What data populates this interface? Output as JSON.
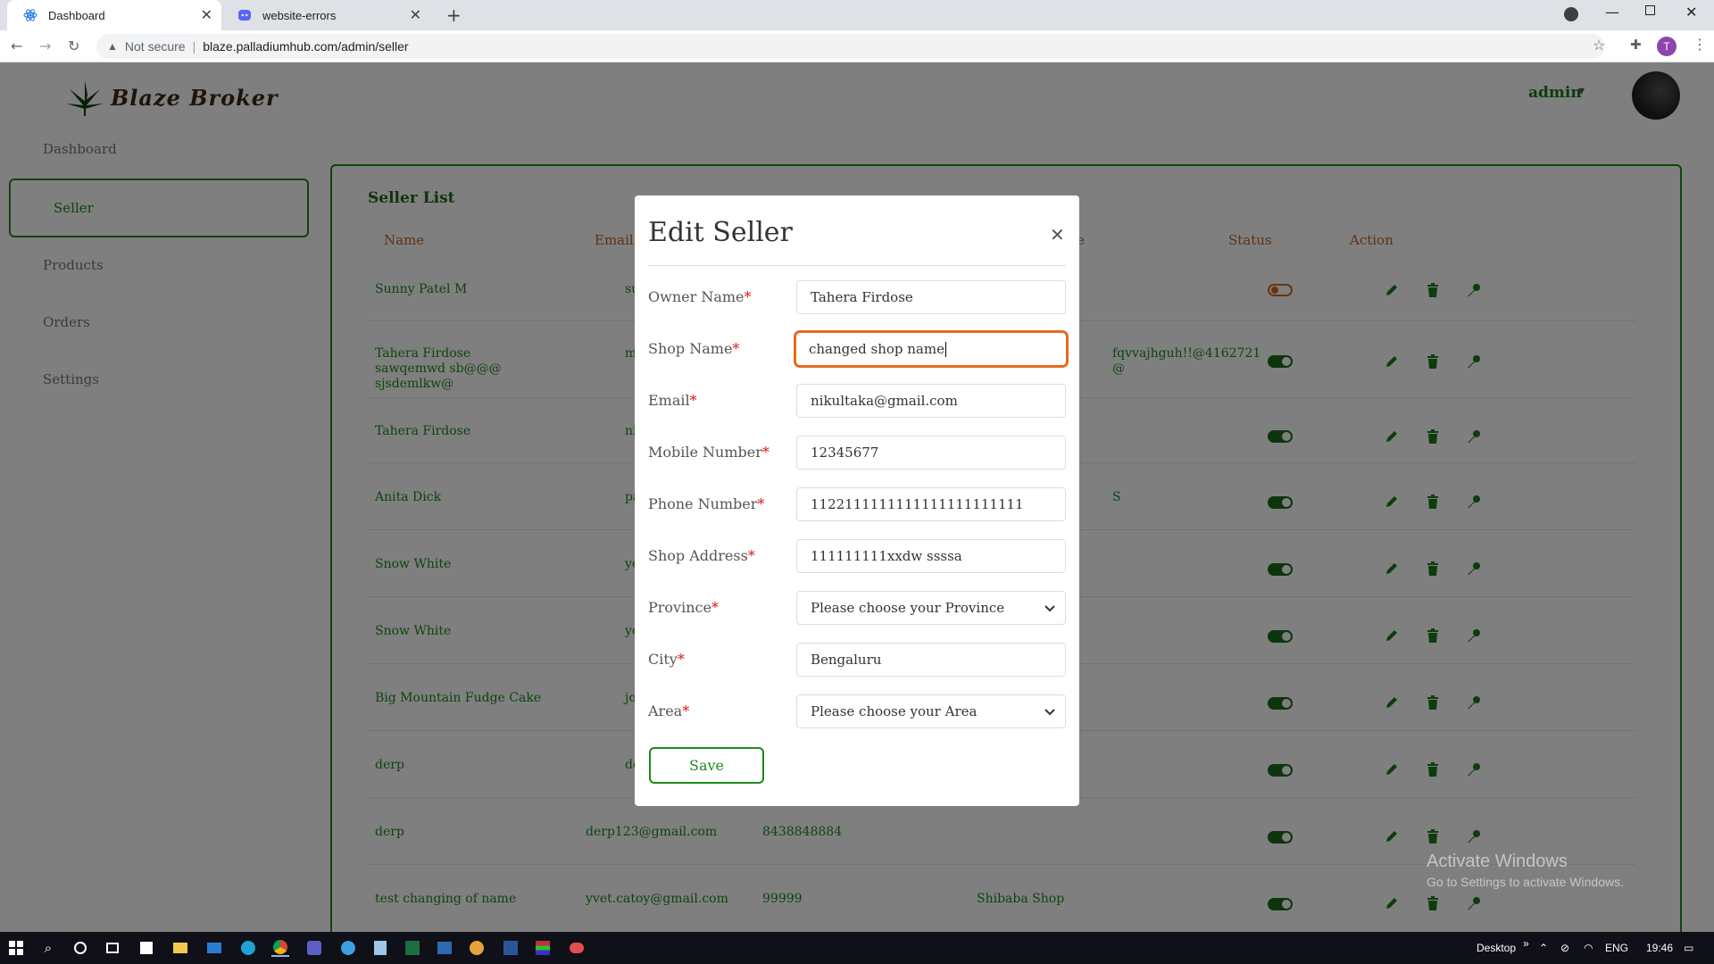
{
  "browser": {
    "tabs": [
      {
        "title": "Dashboard",
        "active": true
      },
      {
        "title": "website-errors",
        "active": false
      }
    ],
    "security_label": "Not secure",
    "url": "blaze.palladiumhub.com/admin/seller",
    "profile_initial": "T"
  },
  "header": {
    "logo_text": "Blaze Broker",
    "user_name": "admin"
  },
  "sidebar": {
    "items": [
      {
        "label": "Dashboard"
      },
      {
        "label": "Seller"
      },
      {
        "label": "Products"
      },
      {
        "label": "Orders"
      },
      {
        "label": "Settings"
      }
    ]
  },
  "seller_list": {
    "title": "Seller List",
    "columns": {
      "name": "Name",
      "email": "Email",
      "e": "e",
      "status": "Status",
      "action": "Action"
    },
    "rows": [
      {
        "name": "Sunny Patel M",
        "email": "sunnypa",
        "mobile": "",
        "shop": "",
        "status_on": false
      },
      {
        "name": "Tahera Firdose sawqemwd sb@@@ sjsdemlkw@",
        "email": "mapatel9",
        "mobile": "",
        "shop": "fqvvajhguh!!@4162721 @",
        "status_on": true
      },
      {
        "name": "Tahera Firdose",
        "email": "nikultaka",
        "mobile": "",
        "shop": "",
        "status_on": true
      },
      {
        "name": "Anita Dick",
        "email": "pacecar7",
        "mobile": "",
        "shop": "S",
        "status_on": true
      },
      {
        "name": "Snow White",
        "email": "yeyococ",
        "mobile": "",
        "shop": "",
        "status_on": true
      },
      {
        "name": "Snow White",
        "email": "yeyococ",
        "mobile": "",
        "shop": "",
        "status_on": true
      },
      {
        "name": "Big Mountain Fudge Cake",
        "email": "johnredc",
        "mobile": "",
        "shop": "",
        "status_on": true
      },
      {
        "name": "derp",
        "email": "derp@g",
        "mobile": "",
        "shop": "",
        "status_on": true
      },
      {
        "name": "derp",
        "email": "derp123@gmail.com",
        "mobile": "8438848884",
        "shop": "",
        "status_on": true
      },
      {
        "name": "test changing of name",
        "email": "yvet.catoy@gmail.com",
        "mobile": "99999",
        "shop": "Shibaba Shop",
        "status_on": true
      }
    ]
  },
  "modal": {
    "title": "Edit Seller",
    "fields": [
      {
        "label": "Owner Name",
        "value": "Tahera Firdose",
        "type": "text"
      },
      {
        "label": "Shop Name",
        "value": "changed shop name",
        "type": "text",
        "focused": true
      },
      {
        "label": "Email",
        "value": "nikultaka@gmail.com",
        "type": "text"
      },
      {
        "label": "Mobile Number",
        "value": "12345677",
        "type": "text"
      },
      {
        "label": "Phone Number",
        "value": "1122111111111111111111111",
        "type": "text"
      },
      {
        "label": "Shop Address",
        "value": "111111111xxdw ssssa",
        "type": "text"
      },
      {
        "label": "Province",
        "value": "Please choose your Province",
        "type": "select"
      },
      {
        "label": "City",
        "value": "Bengaluru",
        "type": "text"
      },
      {
        "label": "Area",
        "value": "Please choose your Area",
        "type": "select"
      }
    ],
    "required_mark": "*",
    "save_label": "Save"
  },
  "watermark": {
    "line1": "Activate Windows",
    "line2": "Go to Settings to activate Windows."
  },
  "taskbar": {
    "desktop_label": "Desktop",
    "language": "ENG",
    "time": "19:46"
  },
  "colors": {
    "brand_green": "#1a8a1a",
    "header_orange": "#c0622b",
    "focus_orange": "#e8691e",
    "required_red": "#e01515"
  }
}
